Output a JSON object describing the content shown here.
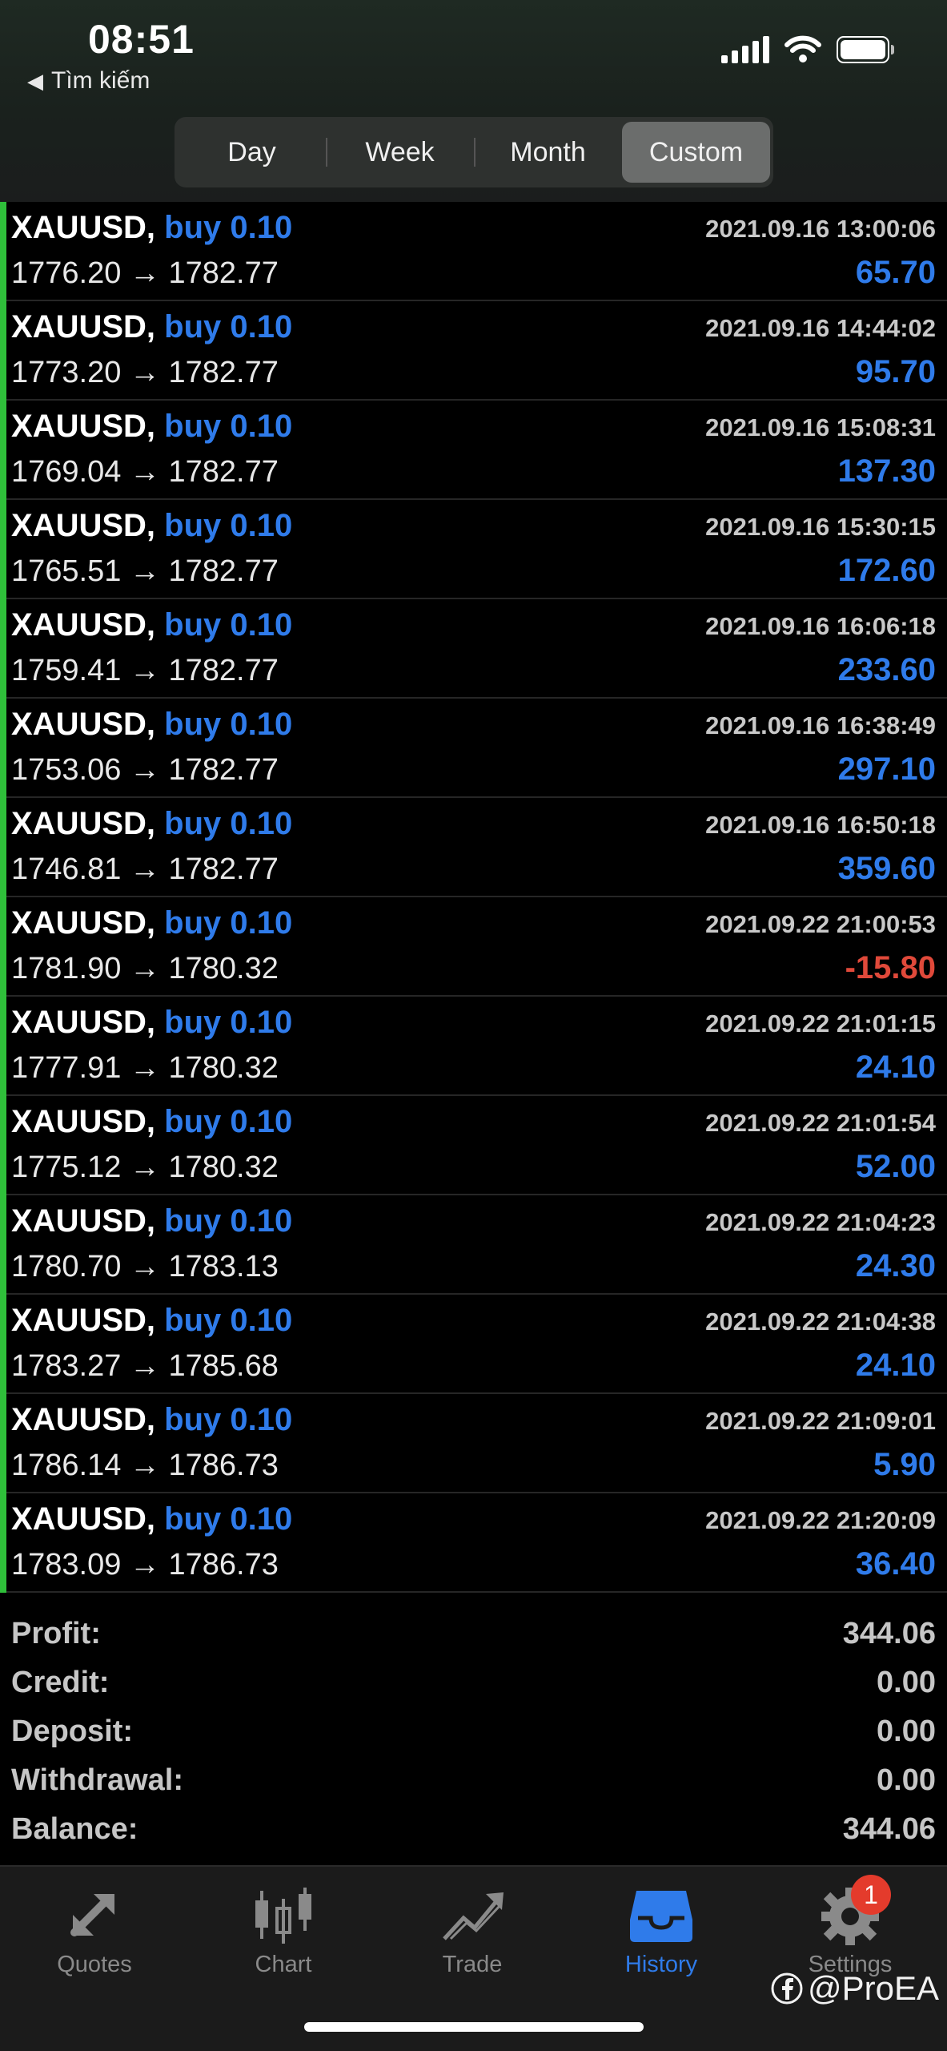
{
  "status_bar": {
    "time": "08:51",
    "back_label": "Tìm kiếm"
  },
  "periods": [
    {
      "label": "Day",
      "active": false
    },
    {
      "label": "Week",
      "active": false
    },
    {
      "label": "Month",
      "active": false
    },
    {
      "label": "Custom",
      "active": true
    }
  ],
  "trades": [
    {
      "symbol": "XAUUSD,",
      "side": "buy 0.10",
      "time": "2021.09.16 13:00:06",
      "open": "1776.20",
      "close": "1782.77",
      "profit": "65.70",
      "negative": false
    },
    {
      "symbol": "XAUUSD,",
      "side": "buy 0.10",
      "time": "2021.09.16 14:44:02",
      "open": "1773.20",
      "close": "1782.77",
      "profit": "95.70",
      "negative": false
    },
    {
      "symbol": "XAUUSD,",
      "side": "buy 0.10",
      "time": "2021.09.16 15:08:31",
      "open": "1769.04",
      "close": "1782.77",
      "profit": "137.30",
      "negative": false
    },
    {
      "symbol": "XAUUSD,",
      "side": "buy 0.10",
      "time": "2021.09.16 15:30:15",
      "open": "1765.51",
      "close": "1782.77",
      "profit": "172.60",
      "negative": false
    },
    {
      "symbol": "XAUUSD,",
      "side": "buy 0.10",
      "time": "2021.09.16 16:06:18",
      "open": "1759.41",
      "close": "1782.77",
      "profit": "233.60",
      "negative": false
    },
    {
      "symbol": "XAUUSD,",
      "side": "buy 0.10",
      "time": "2021.09.16 16:38:49",
      "open": "1753.06",
      "close": "1782.77",
      "profit": "297.10",
      "negative": false
    },
    {
      "symbol": "XAUUSD,",
      "side": "buy 0.10",
      "time": "2021.09.16 16:50:18",
      "open": "1746.81",
      "close": "1782.77",
      "profit": "359.60",
      "negative": false
    },
    {
      "symbol": "XAUUSD,",
      "side": "buy 0.10",
      "time": "2021.09.22 21:00:53",
      "open": "1781.90",
      "close": "1780.32",
      "profit": "-15.80",
      "negative": true
    },
    {
      "symbol": "XAUUSD,",
      "side": "buy 0.10",
      "time": "2021.09.22 21:01:15",
      "open": "1777.91",
      "close": "1780.32",
      "profit": "24.10",
      "negative": false
    },
    {
      "symbol": "XAUUSD,",
      "side": "buy 0.10",
      "time": "2021.09.22 21:01:54",
      "open": "1775.12",
      "close": "1780.32",
      "profit": "52.00",
      "negative": false
    },
    {
      "symbol": "XAUUSD,",
      "side": "buy 0.10",
      "time": "2021.09.22 21:04:23",
      "open": "1780.70",
      "close": "1783.13",
      "profit": "24.30",
      "negative": false
    },
    {
      "symbol": "XAUUSD,",
      "side": "buy 0.10",
      "time": "2021.09.22 21:04:38",
      "open": "1783.27",
      "close": "1785.68",
      "profit": "24.10",
      "negative": false
    },
    {
      "symbol": "XAUUSD,",
      "side": "buy 0.10",
      "time": "2021.09.22 21:09:01",
      "open": "1786.14",
      "close": "1786.73",
      "profit": "5.90",
      "negative": false
    },
    {
      "symbol": "XAUUSD,",
      "side": "buy 0.10",
      "time": "2021.09.22 21:20:09",
      "open": "1783.09",
      "close": "1786.73",
      "profit": "36.40",
      "negative": false
    }
  ],
  "summary": [
    {
      "label": "Profit:",
      "value": "344.06"
    },
    {
      "label": "Credit:",
      "value": "0.00"
    },
    {
      "label": "Deposit:",
      "value": "0.00"
    },
    {
      "label": "Withdrawal:",
      "value": "0.00"
    },
    {
      "label": "Balance:",
      "value": "344.06"
    }
  ],
  "tabs": [
    {
      "label": "Quotes",
      "icon": "quotes-icon",
      "active": false
    },
    {
      "label": "Chart",
      "icon": "chart-icon",
      "active": false
    },
    {
      "label": "Trade",
      "icon": "trade-icon",
      "active": false
    },
    {
      "label": "History",
      "icon": "history-icon",
      "active": true
    },
    {
      "label": "Settings",
      "icon": "gear-icon",
      "active": false,
      "badge": "1"
    }
  ],
  "watermark": "@ProEA",
  "colors": {
    "accent": "#2f7bea",
    "negative": "#e0493a",
    "position_bar": "#2fbf3a"
  }
}
